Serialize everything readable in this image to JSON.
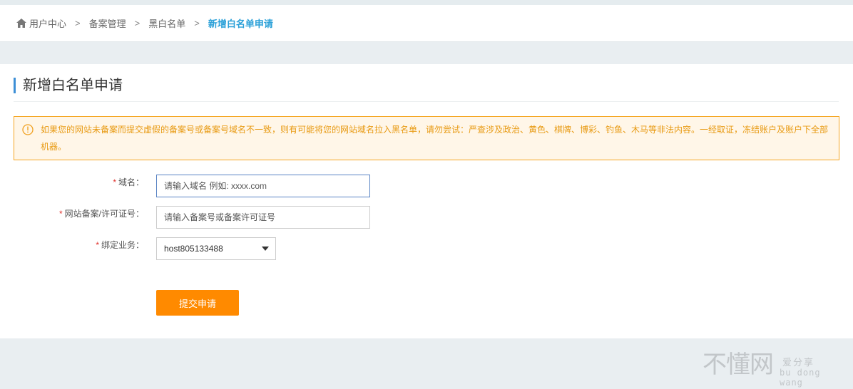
{
  "breadcrumb": {
    "items": [
      "用户中心",
      "备案管理",
      "黑白名单"
    ],
    "current": "新增白名单申请",
    "separator": ">"
  },
  "page": {
    "title": "新增白名单申请"
  },
  "notice": {
    "text": "如果您的网站未备案而提交虚假的备案号或备案号域名不一致，则有可能将您的网站域名拉入黑名单，请勿尝试：严查涉及政治、黄色、棋牌、博彩、钓鱼、木马等非法内容。一经取证，冻结账户及账户下全部机器。"
  },
  "form": {
    "required_mark": "*",
    "domain": {
      "label": "域名：",
      "placeholder": "请输入域名 例如: xxxx.com",
      "value": ""
    },
    "license": {
      "label": "网站备案/许可证号：",
      "placeholder": "请输入备案号或备案许可证号",
      "value": ""
    },
    "service": {
      "label": "绑定业务：",
      "selected": "host805133488"
    },
    "submit_label": "提交申请"
  },
  "watermark": {
    "main": "不懂网",
    "sub1": "爱分享",
    "sub2": "bu dong wang"
  },
  "colors": {
    "accent_blue": "#2aa0d8",
    "title_bar": "#3d8fd6",
    "notice_border": "#f5a623",
    "notice_bg": "#fff6e8",
    "submit_bg": "#ff8a00",
    "required": "#e0322d"
  }
}
